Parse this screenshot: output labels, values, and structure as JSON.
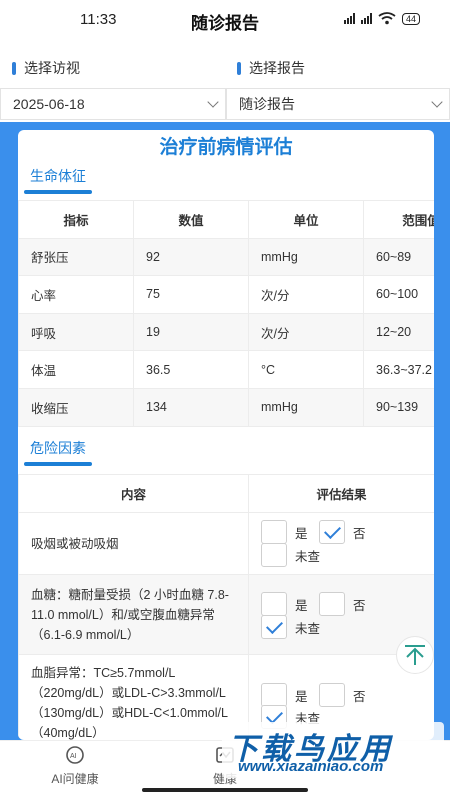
{
  "status_bar": {
    "time": "11:33",
    "battery": "44"
  },
  "header": {
    "title": "随诊报告"
  },
  "selectors": {
    "visit_label": "选择访视",
    "report_label": "选择报告",
    "visit_value": "2025-06-18",
    "report_value": "随诊报告"
  },
  "card": {
    "title": "治疗前病情评估",
    "vitals": {
      "section_title": "生命体征",
      "columns": [
        "指标",
        "数值",
        "单位",
        "范围值"
      ],
      "rows": [
        [
          "舒张压",
          "92",
          "mmHg",
          "60~89"
        ],
        [
          "心率",
          "75",
          "次/分",
          "60~100"
        ],
        [
          "呼吸",
          "19",
          "次/分",
          "12~20"
        ],
        [
          "体温",
          "36.5",
          "°C",
          "36.3~37.2"
        ],
        [
          "收缩压",
          "134",
          "mmHg",
          "90~139"
        ]
      ]
    },
    "risk": {
      "section_title": "危险因素",
      "columns": [
        "内容",
        "评估结果"
      ],
      "option_labels": {
        "yes": "是",
        "no": "否",
        "unchecked": "未查"
      },
      "rows": [
        {
          "content": "吸烟或被动吸烟",
          "selected": "no"
        },
        {
          "content": "血糖：糖耐量受损（2 小时血糖 7.8-11.0 mmol/L）和/或空腹血糖异常（6.1-6.9 mmol/L）",
          "selected": "unchecked"
        },
        {
          "content": "血脂异常：TC≥5.7mmol/L（220mg/dL）或LDL-C>3.3mmol/L（130mg/dL）或HDL-C<1.0mmol/L（40mg/dL）",
          "selected": "unchecked"
        }
      ]
    }
  },
  "tabbar": {
    "tabs": [
      "AI问健康",
      "健康"
    ]
  },
  "watermark": {
    "main": "下载鸟应用",
    "sub": "www.xiazainiao.com"
  },
  "colors": {
    "accent": "#1c7fd6",
    "background_blue": "#3a8fec",
    "check": "#2f7fd8"
  }
}
